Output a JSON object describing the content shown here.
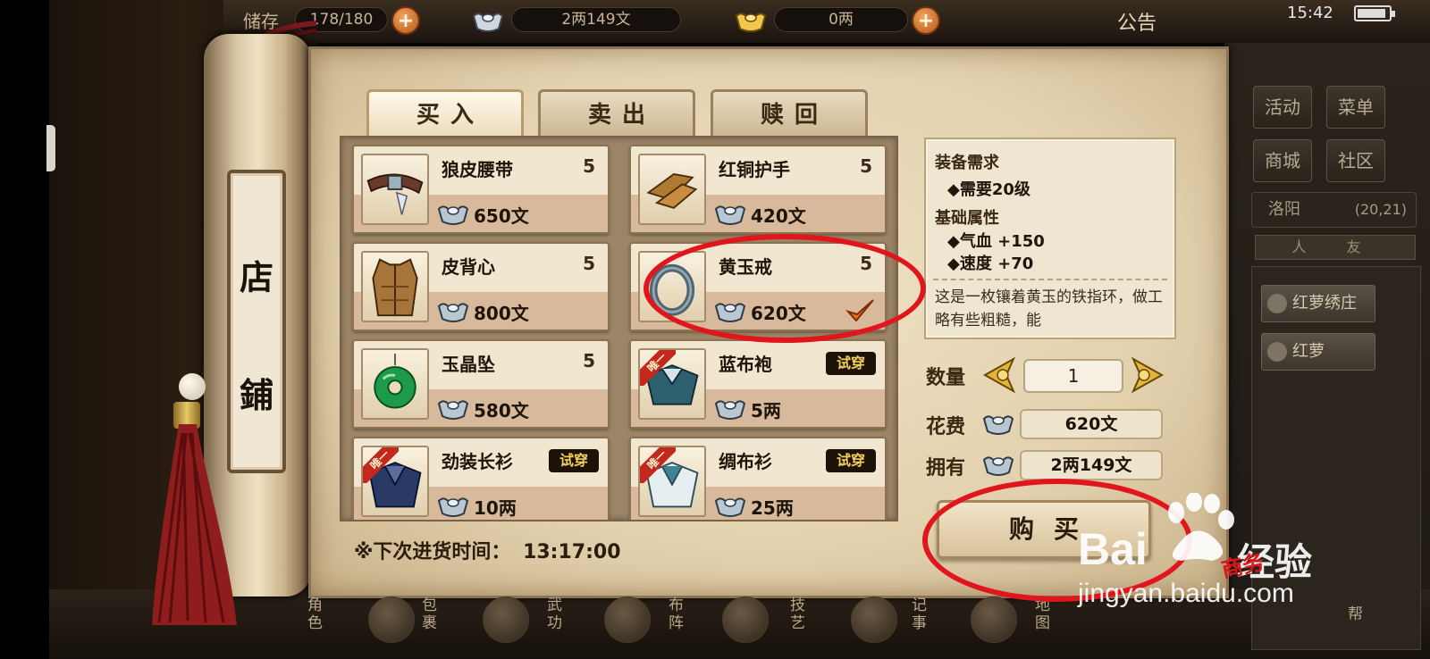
{
  "topbar": {
    "storage_label": "储存",
    "storage": "178/180",
    "silver_money": "2两149文",
    "gold_money": "0两",
    "notice": "公告"
  },
  "status_bar": {
    "time": "15:42",
    "battery_level": 0.9
  },
  "roller": {
    "char1": "店",
    "char2": "鋪"
  },
  "tabs": [
    {
      "label": "买入",
      "active": true
    },
    {
      "label": "卖出",
      "active": false
    },
    {
      "label": "赎回",
      "active": false
    }
  ],
  "items": [
    {
      "name": "狼皮腰带",
      "level": "5",
      "price": "650文",
      "icon": "belt-icon",
      "unique": false,
      "tryon": false,
      "unique_label": "",
      "tryon_label": ""
    },
    {
      "name": "红铜护手",
      "level": "5",
      "price": "420文",
      "icon": "gauntlet-icon",
      "unique": false,
      "tryon": false,
      "unique_label": "",
      "tryon_label": ""
    },
    {
      "name": "皮背心",
      "level": "5",
      "price": "800文",
      "icon": "vest-icon",
      "unique": false,
      "tryon": false,
      "unique_label": "",
      "tryon_label": ""
    },
    {
      "name": "黄玉戒",
      "level": "5",
      "price": "620文",
      "icon": "ring-icon",
      "unique": false,
      "tryon": false,
      "unique_label": "",
      "tryon_label": "",
      "selected": true
    },
    {
      "name": "玉晶坠",
      "level": "5",
      "price": "580文",
      "icon": "jade-pendant-icon",
      "unique": false,
      "tryon": false,
      "unique_label": "",
      "tryon_label": ""
    },
    {
      "name": "蓝布袍",
      "level": "",
      "price": "5两",
      "icon": "blue-robe-icon",
      "unique": true,
      "tryon": true,
      "unique_label": "唯一",
      "tryon_label": "试穿"
    },
    {
      "name": "劲装长衫",
      "level": "",
      "price": "10两",
      "icon": "dark-robe-icon",
      "unique": true,
      "tryon": true,
      "unique_label": "唯一",
      "tryon_label": "试穿"
    },
    {
      "name": "绸布衫",
      "level": "",
      "price": "25两",
      "icon": "silk-shirt-icon",
      "unique": true,
      "tryon": true,
      "unique_label": "唯一",
      "tryon_label": "试穿"
    }
  ],
  "restock": {
    "label": "※下次进货时间：",
    "time": "13:17:00"
  },
  "detail": {
    "req_heading": "装备需求",
    "req_level": "◆需要20级",
    "attr_heading": "基础属性",
    "attr_hp": "◆气血 +150",
    "attr_speed": "◆速度 +70",
    "description": "这是一枚镶着黄玉的铁指环，做工略有些粗糙，能"
  },
  "purchase": {
    "qty_label": "数量",
    "qty_value": "1",
    "cost_label": "花费",
    "cost_value": "620文",
    "own_label": "拥有",
    "own_value": "2两149文",
    "buy_label": "购买"
  },
  "sidebar": {
    "activity": "活动",
    "menu": "菜单",
    "mall": "商城",
    "community": "社区",
    "location": "洛阳",
    "coords": "(20,21)",
    "mini_tabs": "人 友",
    "npc_shop": "红萝绣庄",
    "npc_name": "红萝"
  },
  "dock": [
    "角色",
    "包裹",
    "武功",
    "布阵",
    "技艺",
    "记事",
    "地图",
    "帮"
  ],
  "watermark": {
    "brand": "Bai",
    "brand2": "经验",
    "brand_red": "商务",
    "url": "jingyan.baidu.com"
  },
  "colors": {
    "annotation_red": "#e0161c",
    "tryon_gold": "#f2cf5a",
    "price_band": "#d9b99c"
  }
}
